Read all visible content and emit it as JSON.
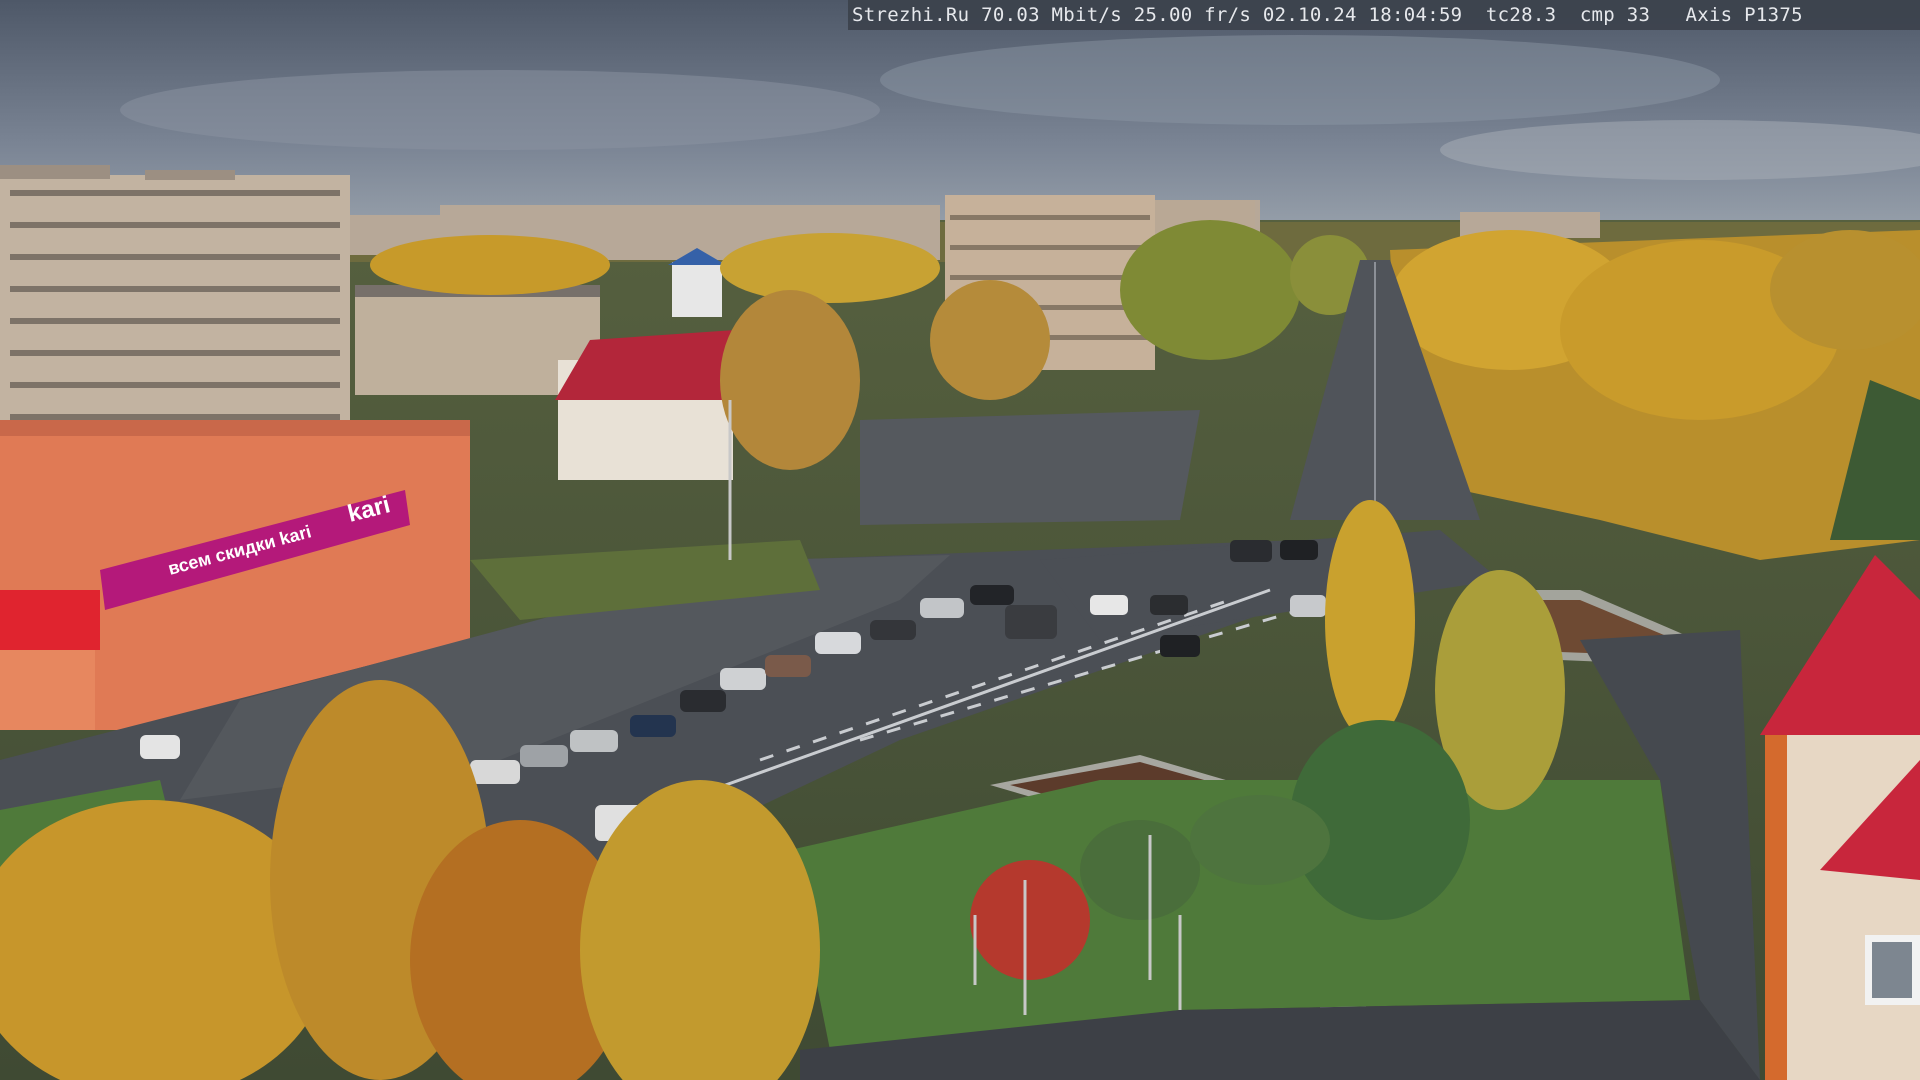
{
  "overlay": {
    "text": "Strezhi.Ru 70.03 Mbit/s 25.00 fr/s 02.10.24 18:04:59  tc28.3  cmp 33   Axis P1375"
  },
  "signage": {
    "store_sign": "kari",
    "store_banner": "всем скидки kari"
  },
  "colors": {
    "sky": "#5d6878",
    "trees_autumn": "#c79a2a",
    "road": "#4b4f55",
    "grass": "#4f7a3a",
    "store_facade": "#e07a55",
    "store_banner": "#b4197a",
    "building_red_roof": "#b3263a"
  }
}
